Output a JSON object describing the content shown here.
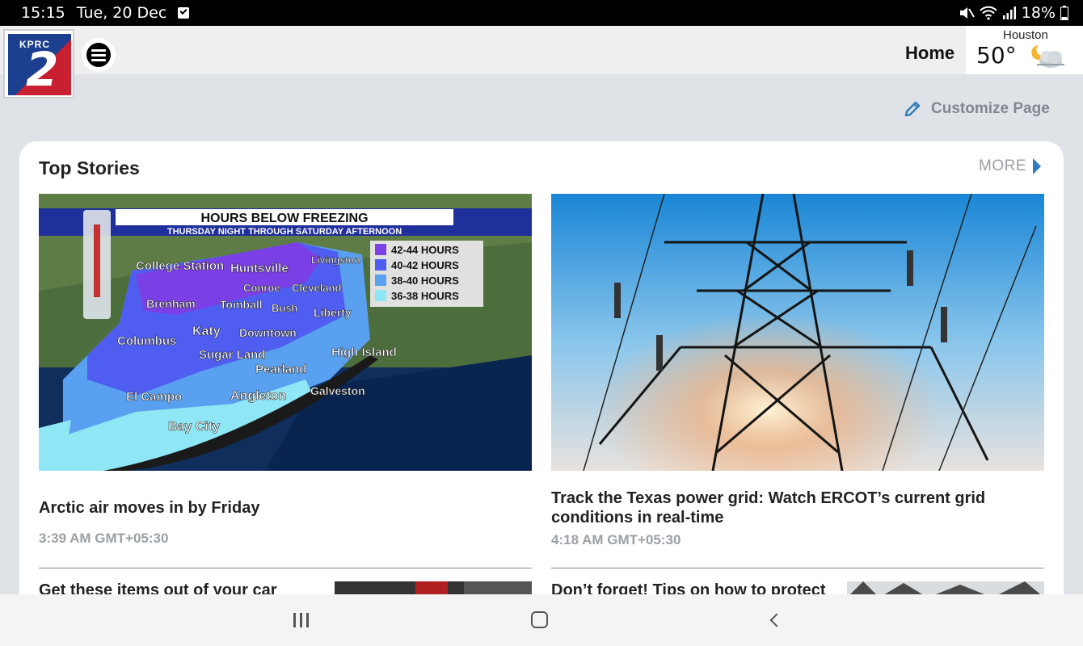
{
  "status_bar": {
    "time": "15:15",
    "date": "Tue, 20 Dec",
    "battery": "18%",
    "icons": [
      "calendar-check-icon",
      "mute-icon",
      "wifi-icon",
      "signal-icon",
      "battery-icon"
    ]
  },
  "header": {
    "logo_text": "KPRC",
    "logo_number": "2",
    "nav_home": "Home",
    "weather": {
      "city": "Houston",
      "temperature": "50°",
      "icon": "partly-cloudy-night-icon"
    }
  },
  "toolbar": {
    "customize_label": "Customize Page"
  },
  "section": {
    "title": "Top Stories",
    "more_label": "MORE"
  },
  "stories": [
    {
      "headline": "Arctic air moves in by Friday",
      "time": "3:39 AM GMT+05:30",
      "map": {
        "title": "HOURS BELOW FREEZING",
        "subtitle": "THURSDAY NIGHT THROUGH SATURDAY AFTERNOON",
        "legend": [
          {
            "label": "42-44 HOURS",
            "color": "#7b3fe6"
          },
          {
            "label": "40-42 HOURS",
            "color": "#4f5ef0"
          },
          {
            "label": "38-40 HOURS",
            "color": "#5aa0f0"
          },
          {
            "label": "36-38 HOURS",
            "color": "#8fe6f4"
          }
        ],
        "places": [
          "College Station",
          "Huntsville",
          "Livingston",
          "Conroe",
          "Cleveland",
          "Brenham",
          "Tomball",
          "Bush",
          "Liberty",
          "Columbus",
          "Katy",
          "Downtown",
          "Sugar Land",
          "High Island",
          "Pearland",
          "El Campo",
          "Angleton",
          "Galveston",
          "Bay City"
        ]
      }
    },
    {
      "headline": "Track the Texas power grid: Watch ERCOT’s current grid conditions in real-time",
      "time": "4:18 AM GMT+05:30"
    }
  ],
  "next_stories": [
    {
      "headline": "Get these items out of your car ahead"
    },
    {
      "headline": "Don’t forget! Tips on how to protect"
    }
  ],
  "nav": {
    "recent": "recent-apps-icon",
    "home": "home-icon",
    "back": "back-icon"
  }
}
